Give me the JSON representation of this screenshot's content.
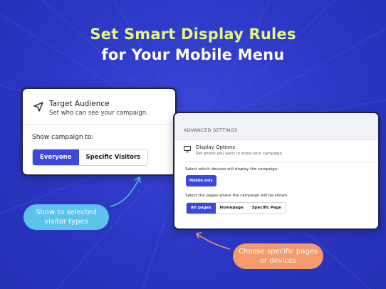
{
  "headline": {
    "line1": "Set Smart Display Rules",
    "line2": "for Your Mobile Menu"
  },
  "target_audience_card": {
    "icon": "navigation-arrow-icon",
    "title": "Target Audience",
    "subtitle": "Set who can see your campaign.",
    "show_label": "Show campaign to:",
    "options": [
      "Everyone",
      "Specific Visitors"
    ],
    "selected": "Everyone"
  },
  "settings_card": {
    "section_header": "ADVANCED SETTINGS",
    "display_icon": "monitor-icon",
    "display_title": "Display Options",
    "display_subtitle": "Set where you want to show your campaign.",
    "devices_label": "Select which devices will display the campaign:",
    "device_button": "Mobile only",
    "pages_label": "Select the pages where the campaign will be shown:",
    "page_options": [
      "All pages",
      "Homepage",
      "Specific Page"
    ],
    "selected_page": "All pages"
  },
  "callouts": {
    "visitor_types": "Show to selected visitor types",
    "visitor_types_line1": "Show to selected",
    "visitor_types_line2": "visitor types",
    "pages_devices_line1": "Choose specific pages",
    "pages_devices_line2": "or devices"
  },
  "colors": {
    "background": "#2b36c4",
    "headline_accent": "#e9f47a",
    "primary_button": "#3b48e0",
    "callout_blue": "#5bc3ec",
    "callout_orange": "#f49a6c"
  }
}
